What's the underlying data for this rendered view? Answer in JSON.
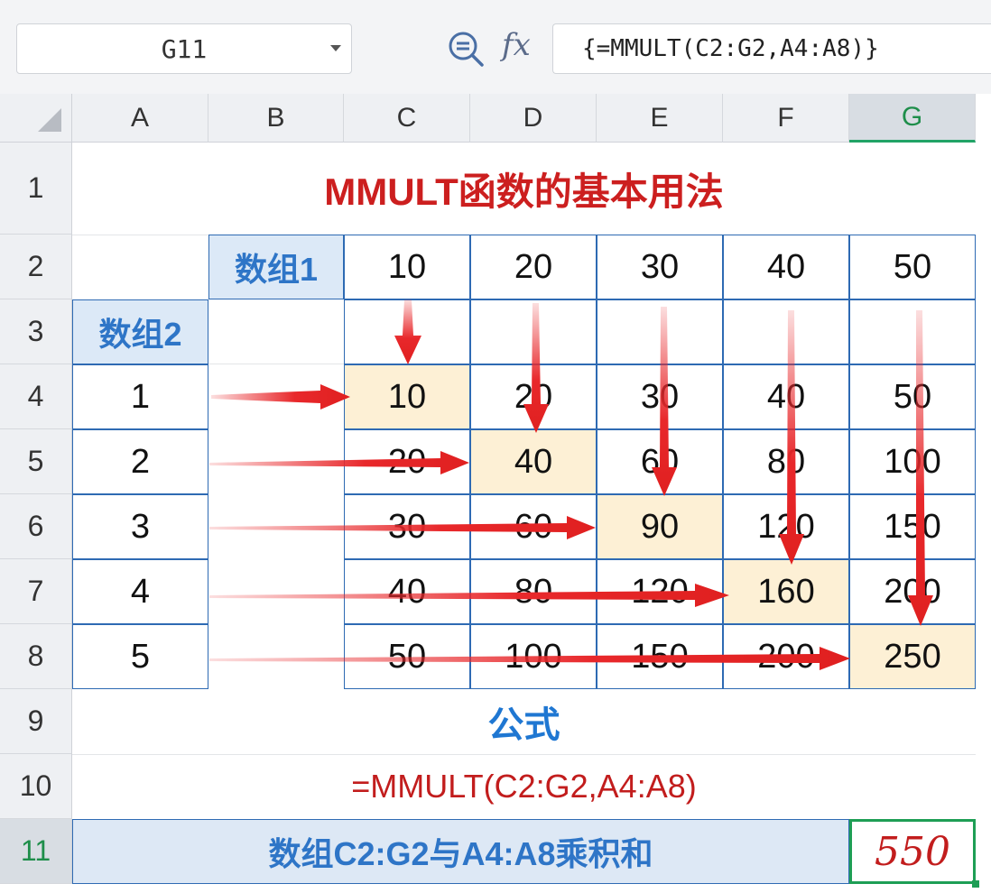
{
  "formula_bar": {
    "name_box": "G11",
    "formula": "{=MMULT(C2:G2,A4:A8)}"
  },
  "icons": {
    "zoom": "zoom-formula-icon",
    "fx": "fx",
    "dropdown": "chevron-down-icon"
  },
  "columns": [
    "A",
    "B",
    "C",
    "D",
    "E",
    "F",
    "G"
  ],
  "rows": [
    "1",
    "2",
    "3",
    "4",
    "5",
    "6",
    "7",
    "8",
    "9",
    "10",
    "11"
  ],
  "selected": {
    "column": "G",
    "row": "11"
  },
  "sheet": {
    "title": "MMULT函数的基本用法",
    "array1_label": "数组1",
    "array1_values": [
      "10",
      "20",
      "30",
      "40",
      "50"
    ],
    "array2_label": "数组2",
    "array2_values": [
      "1",
      "2",
      "3",
      "4",
      "5"
    ],
    "products": [
      [
        "10",
        "20",
        "30",
        "40",
        "50"
      ],
      [
        "20",
        "40",
        "60",
        "80",
        "100"
      ],
      [
        "30",
        "60",
        "90",
        "120",
        "150"
      ],
      [
        "40",
        "80",
        "120",
        "160",
        "200"
      ],
      [
        "50",
        "100",
        "150",
        "200",
        "250"
      ]
    ],
    "formula_heading": "公式",
    "formula_text": "=MMULT(C2:G2,A4:A8)",
    "result_label": "数组C2:G2与A4:A8乘积和",
    "result_value": "550"
  },
  "colors": {
    "title_red": "#cc1f1f",
    "header_blue": "#2e75c7",
    "highlight": "#fdf0d5",
    "selection_green": "#1e9e55",
    "arrow_red": "#e8282b"
  }
}
